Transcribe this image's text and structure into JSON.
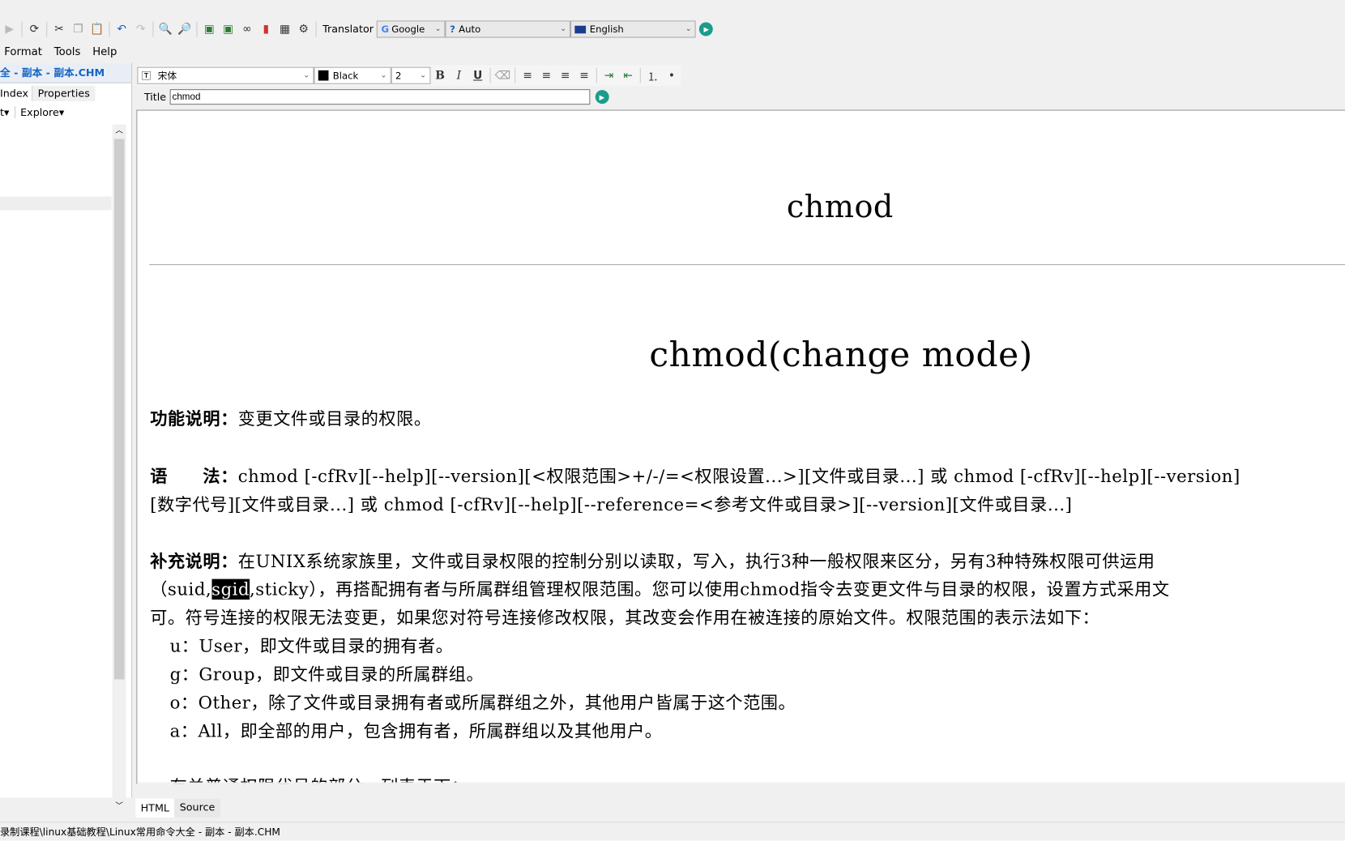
{
  "toolbar": {
    "translator_label": "Translator",
    "engine": "Google",
    "source_lang": "Auto",
    "target_lang": "English"
  },
  "menu": [
    "Format",
    "Tools",
    "Help"
  ],
  "sidebar": {
    "file_title": "全 - 副本 - 副本.CHM",
    "tabs": [
      "Index",
      "Properties"
    ],
    "buttons": [
      "t",
      "Explore"
    ]
  },
  "format_bar": {
    "font": "宋体",
    "color": "Black",
    "size": "2",
    "bold": "B",
    "italic": "I",
    "underline": "U"
  },
  "title_field": {
    "label": "Title",
    "value": "chmod"
  },
  "document": {
    "heading1": "chmod",
    "heading2": "chmod(change mode)",
    "func_label": "功能说明：",
    "func_text": "变更文件或目录的权限。",
    "syntax_label": "语　　法：",
    "syntax_line1": "chmod [-cfRv][--help][--version][<权限范围>+/-/=<权限设置...>][文件或目录...] 或 chmod [-cfRv][--help][--version]",
    "syntax_line2": "[数字代号][文件或目录...] 或 chmod [-cfRv][--help][--reference=<参考文件或目录>][--version][文件或目录...]",
    "supp_label": "补充说明：",
    "supp_line1": "在UNIX系统家族里，文件或目录权限的控制分别以读取，写入，执行3种一般权限来区分，另有3种特殊权限可供运用",
    "supp_line2_a": "（suid,",
    "supp_line2_sel": "sgid",
    "supp_line2_b": ",sticky），再搭配拥有者与所属群组管理权限范围。您可以使用chmod指令去变更文件与目录的权限，设置方式采用文",
    "supp_line3": "可。符号连接的权限无法变更，如果您对符号连接修改权限，其改变会作用在被连接的原始文件。权限范围的表示法如下：",
    "items": [
      "u：User，即文件或目录的拥有者。",
      "g：Group，即文件或目录的所属群组。",
      "o：Other，除了文件或目录拥有者或所属群组之外，其他用户皆属于这个范围。",
      "a：All，即全部的用户，包含拥有者，所属群组以及其他用户。"
    ],
    "cut_line": "有关普通权限代号的部分，列表于下："
  },
  "view_tabs": [
    "HTML",
    "Source"
  ],
  "status_path": "录制课程\\linux基础教程\\Linux常用命令大全 - 副本 - 副本.CHM"
}
